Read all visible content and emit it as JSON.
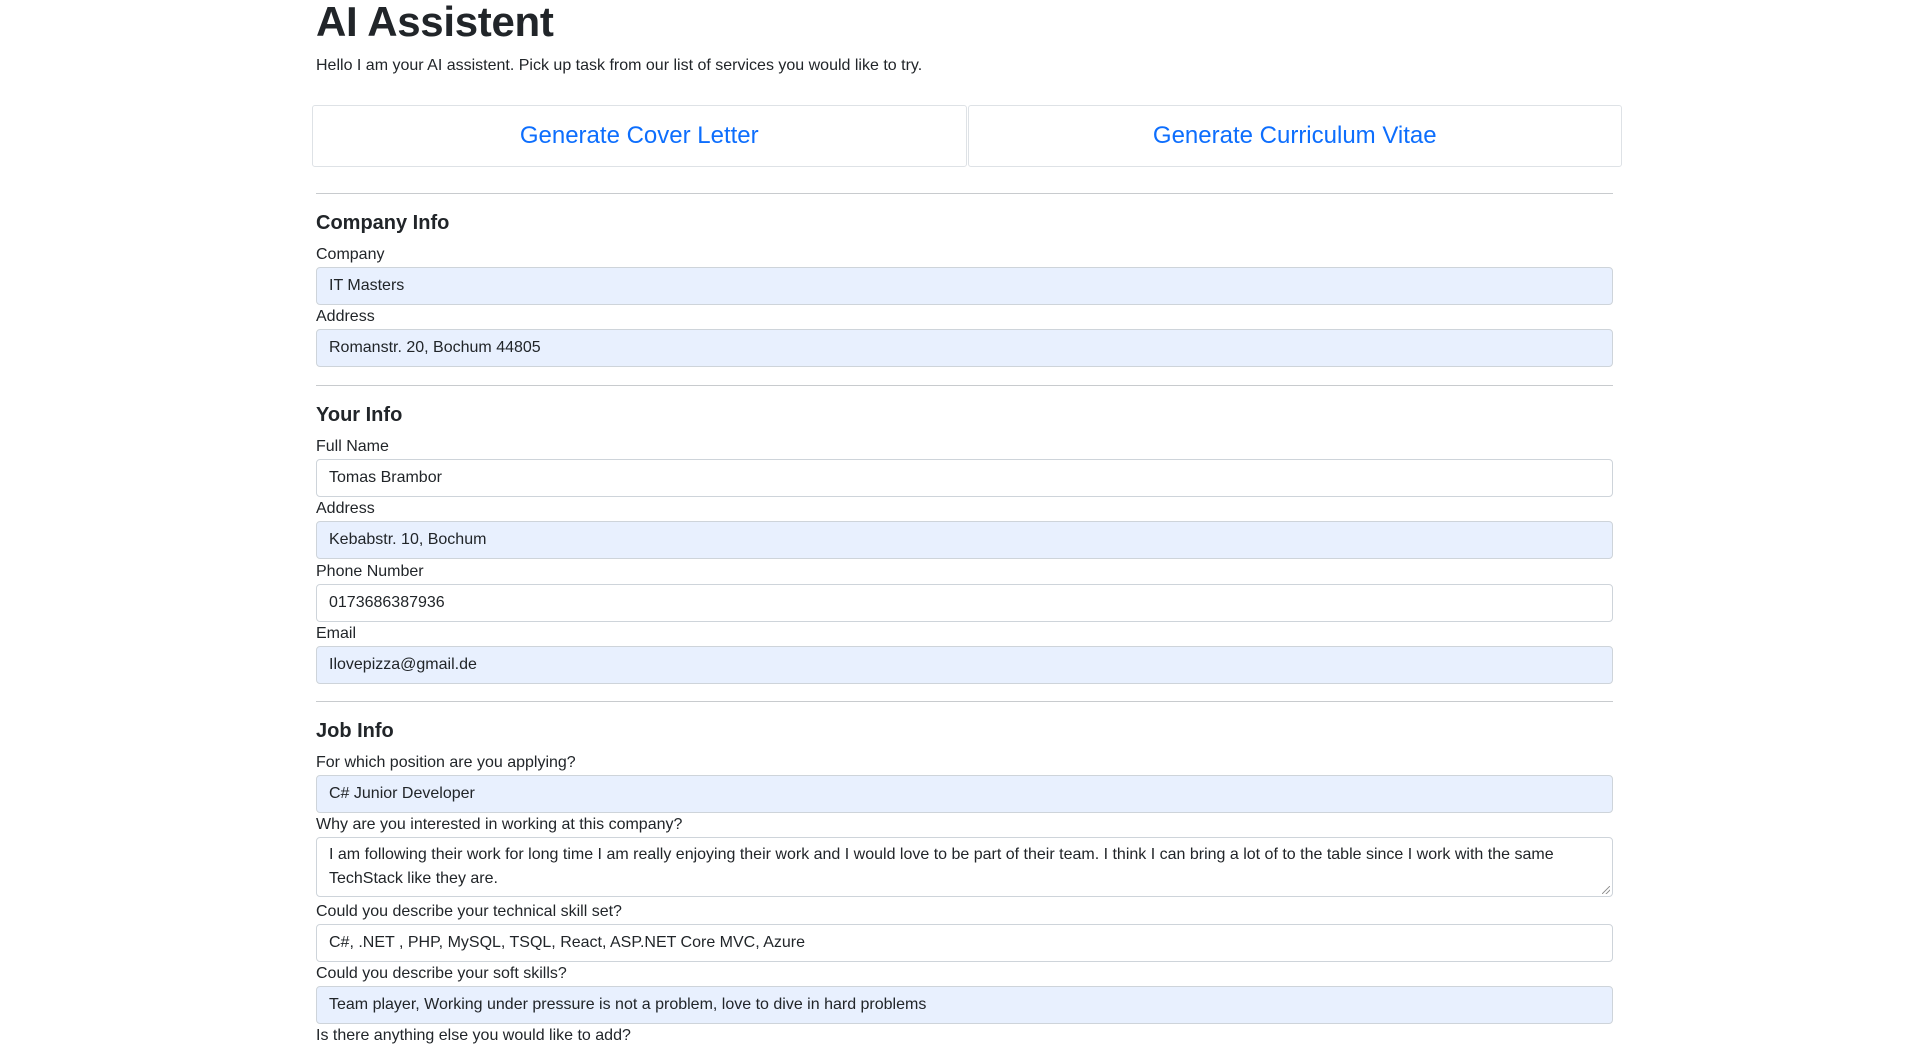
{
  "header": {
    "title": "AI Assistent",
    "subtitle": "Hello I am your AI assistent. Pick up task from our list of services you would like to try."
  },
  "services": {
    "cover_letter": "Generate Cover Letter",
    "cv": "Generate Curriculum Vitae"
  },
  "company_info": {
    "title": "Company Info",
    "company_label": "Company",
    "company_value": "IT Masters",
    "address_label": "Address",
    "address_value": "Romanstr. 20, Bochum 44805"
  },
  "your_info": {
    "title": "Your Info",
    "name_label": "Full Name",
    "name_value": "Tomas Brambor",
    "address_label": "Address",
    "address_value": "Kebabstr. 10, Bochum",
    "phone_label": "Phone Number",
    "phone_value": "0173686387936",
    "email_label": "Email",
    "email_value": "Ilovepizza@gmail.de"
  },
  "job_info": {
    "title": "Job Info",
    "position_label": "For which position are you applying?",
    "position_value": "C# Junior Developer",
    "interest_label": "Why are you interested in working at this company?",
    "interest_value": "I am following their work for long time I am really enjoying their work and I would love to be part of their team. I think I can bring a lot of to the table since I work with the same TechStack like they are.",
    "tech_label": "Could you describe your technical skill set?",
    "tech_value": "C#, .NET , PHP, MySQL, TSQL, React, ASP.NET Core MVC, Azure",
    "soft_label": "Could you describe your soft skills?",
    "soft_value": "Team player, Working under pressure is not a problem, love to dive in hard problems",
    "else_label": "Is there anything else you would like to add?"
  },
  "colors": {
    "link": "#0d6efd",
    "autofill_bg": "#e8f0fe",
    "border": "#ced4da"
  }
}
